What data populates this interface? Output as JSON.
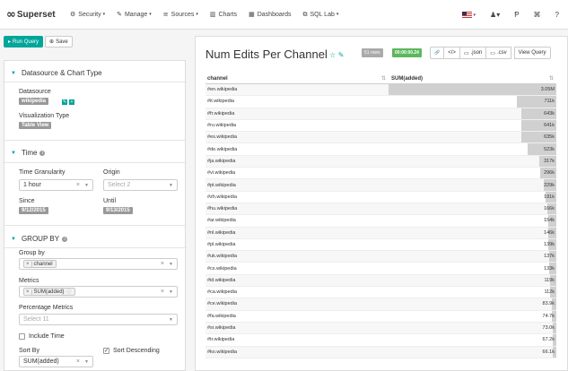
{
  "nav": {
    "brand": "Superset",
    "logo": "∞",
    "items": [
      {
        "icon": "⚙",
        "label": "Security",
        "caret": true
      },
      {
        "icon": "✎",
        "label": "Manage",
        "caret": true
      },
      {
        "icon": "≡",
        "label": "Sources",
        "caret": true
      },
      {
        "icon": "▥",
        "label": "Charts",
        "caret": false
      },
      {
        "icon": "▦",
        "label": "Dashboards",
        "caret": false
      },
      {
        "icon": "⧉",
        "label": "SQL Lab",
        "caret": true
      }
    ],
    "right_icons": [
      "user-icon",
      "brand-p-icon",
      "github-icon",
      "help-icon"
    ],
    "right_glyphs": [
      "♟▾",
      "Ᵽ",
      "⌘",
      "?"
    ]
  },
  "toolbar": {
    "run_label": "Run Query",
    "run_icon": "▸",
    "save_label": "Save",
    "save_icon": "⊕"
  },
  "sections": {
    "datasource": {
      "title": "Datasource & Chart Type",
      "datasource_label": "Datasource",
      "datasource_value": "wikipedia",
      "viz_label": "Visualization Type",
      "viz_value": "Table View"
    },
    "time": {
      "title": "Time",
      "granularity_label": "Time Granularity",
      "granularity_value": "1 hour",
      "origin_label": "Origin",
      "origin_placeholder": "Select 2",
      "since_label": "Since",
      "since_value": "9/12/2015",
      "until_label": "Until",
      "until_value": "9/13/2015"
    },
    "groupby": {
      "title": "GROUP BY",
      "groupby_label": "Group by",
      "groupby_value": "channel",
      "metrics_label": "Metrics",
      "metrics_value": "SUM(added)",
      "pct_label": "Percentage Metrics",
      "pct_placeholder": "Select 11",
      "include_time_label": "Include Time",
      "sortby_label": "Sort By",
      "sortby_value": "SUM(added)",
      "sort_desc_label": "Sort Descending"
    }
  },
  "chart": {
    "title": "Num Edits Per Channel",
    "rows_badge": "51 rows",
    "time_badge": "00:00:00.24",
    "buttons": [
      "🔗",
      "</>",
      ".json",
      ".csv",
      "View Query"
    ]
  },
  "colors": {
    "accent": "#00a699",
    "bar": "#d0d0d0",
    "success": "#5cb85c"
  },
  "chart_data": {
    "type": "table",
    "columns": [
      "channel",
      "SUM(added)"
    ],
    "rows": [
      {
        "channel": "#en.wikipedia",
        "value": 3050000,
        "label": "3.05M"
      },
      {
        "channel": "#it.wikipedia",
        "value": 711000,
        "label": "711k"
      },
      {
        "channel": "#fr.wikipedia",
        "value": 643000,
        "label": "643k"
      },
      {
        "channel": "#ru.wikipedia",
        "value": 641000,
        "label": "641k"
      },
      {
        "channel": "#es.wikipedia",
        "value": 635000,
        "label": "635k"
      },
      {
        "channel": "#de.wikipedia",
        "value": 523000,
        "label": "523k"
      },
      {
        "channel": "#ja.wikipedia",
        "value": 317000,
        "label": "317k"
      },
      {
        "channel": "#vi.wikipedia",
        "value": 296000,
        "label": "296k"
      },
      {
        "channel": "#pt.wikipedia",
        "value": 229000,
        "label": "229k"
      },
      {
        "channel": "#zh.wikipedia",
        "value": 191000,
        "label": "191k"
      },
      {
        "channel": "#hu.wikipedia",
        "value": 166000,
        "label": "166k"
      },
      {
        "channel": "#ar.wikipedia",
        "value": 154000,
        "label": "154k"
      },
      {
        "channel": "#nl.wikipedia",
        "value": 146000,
        "label": "146k"
      },
      {
        "channel": "#pl.wikipedia",
        "value": 139000,
        "label": "139k"
      },
      {
        "channel": "#uk.wikipedia",
        "value": 137000,
        "label": "137k"
      },
      {
        "channel": "#cs.wikipedia",
        "value": 133000,
        "label": "133k"
      },
      {
        "channel": "#id.wikipedia",
        "value": 119000,
        "label": "119k"
      },
      {
        "channel": "#ca.wikipedia",
        "value": 112000,
        "label": "112k"
      },
      {
        "channel": "#ce.wikipedia",
        "value": 83900,
        "label": "83.9k"
      },
      {
        "channel": "#fa.wikipedia",
        "value": 74700,
        "label": "74.7k"
      },
      {
        "channel": "#sr.wikipedia",
        "value": 73000,
        "label": "73.0k"
      },
      {
        "channel": "#tr.wikipedia",
        "value": 67200,
        "label": "67.2k"
      },
      {
        "channel": "#ko.wikipedia",
        "value": 66100,
        "label": "66.1k"
      }
    ]
  }
}
